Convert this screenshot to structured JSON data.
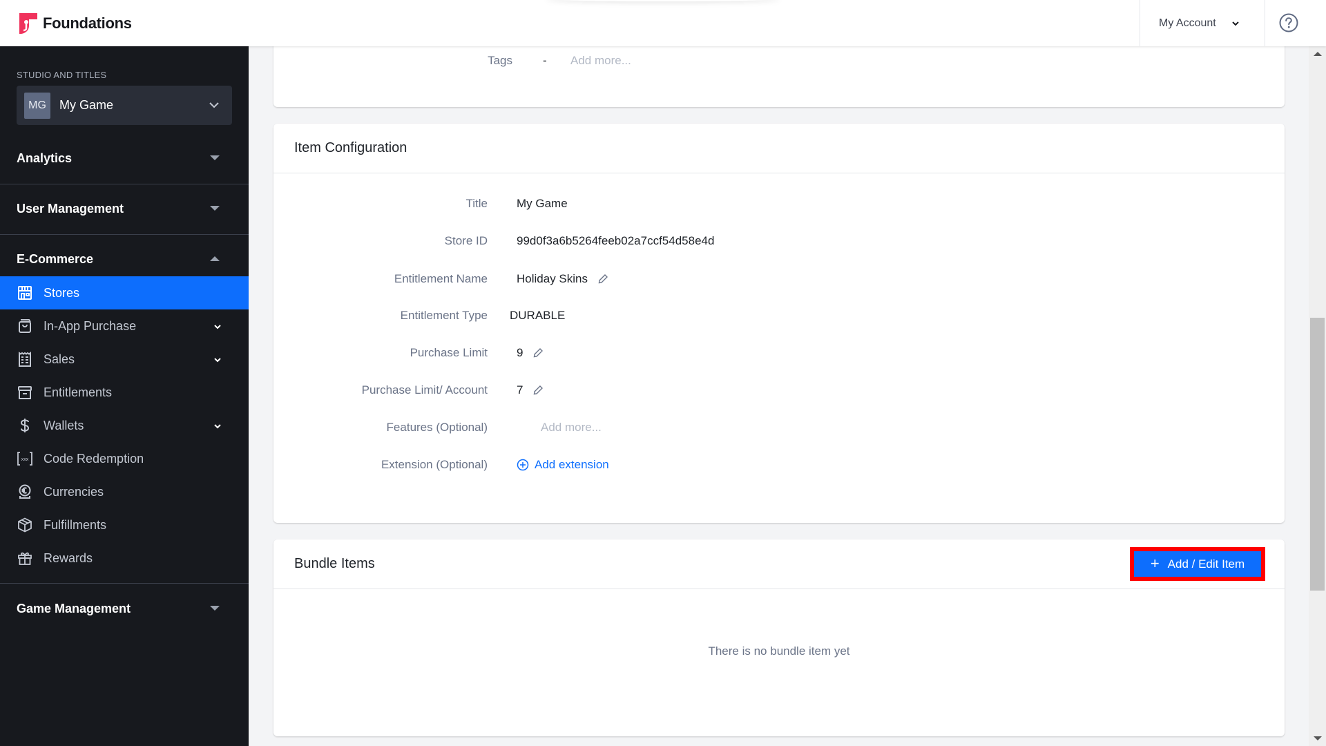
{
  "header": {
    "app_name": "Foundations",
    "account_label": "My Account",
    "brand_color": "#f0325c"
  },
  "sidebar": {
    "studio_label": "STUDIO AND TITLES",
    "studio": {
      "initials": "MG",
      "name": "My Game"
    },
    "sections": [
      {
        "label": "Analytics",
        "expanded": false
      },
      {
        "label": "User Management",
        "expanded": false
      },
      {
        "label": "E-Commerce",
        "expanded": true
      },
      {
        "label": "Game Management",
        "expanded": false
      }
    ],
    "ecommerce_items": [
      {
        "label": "Stores",
        "icon": "store-icon",
        "active": true,
        "has_submenu": false
      },
      {
        "label": "In-App Purchase",
        "icon": "shopping-bag-icon",
        "active": false,
        "has_submenu": true
      },
      {
        "label": "Sales",
        "icon": "receipt-icon",
        "active": false,
        "has_submenu": true
      },
      {
        "label": "Entitlements",
        "icon": "archive-icon",
        "active": false,
        "has_submenu": false
      },
      {
        "label": "Wallets",
        "icon": "dollar-icon",
        "active": false,
        "has_submenu": true
      },
      {
        "label": "Code Redemption",
        "icon": "code-brackets-icon",
        "active": false,
        "has_submenu": false
      },
      {
        "label": "Currencies",
        "icon": "euro-coin-icon",
        "active": false,
        "has_submenu": false
      },
      {
        "label": "Fulfillments",
        "icon": "box-icon",
        "active": false,
        "has_submenu": false
      },
      {
        "label": "Rewards",
        "icon": "gift-icon",
        "active": false,
        "has_submenu": false
      }
    ],
    "active_color": "#0d6efd"
  },
  "top_card": {
    "tags_label": "Tags",
    "tags_value": "-",
    "tags_placeholder": "Add more..."
  },
  "item_configuration": {
    "title": "Item Configuration",
    "rows": [
      {
        "label": "Title",
        "value": "My Game"
      },
      {
        "label": "Store ID",
        "value": "99d0f3a6b5264feeb02a7ccf54d58e4d"
      },
      {
        "label": "Entitlement Name",
        "value": "Holiday Skins",
        "editable": true
      },
      {
        "label": "Entitlement Type",
        "value": "DURABLE"
      },
      {
        "label": "Purchase Limit",
        "value": "9",
        "editable": true
      },
      {
        "label": "Purchase Limit/ Account",
        "value": "7",
        "editable": true
      },
      {
        "label": "Features (Optional)",
        "placeholder": "Add more..."
      },
      {
        "label": "Extension (Optional)",
        "link": "Add extension"
      }
    ]
  },
  "bundle_items": {
    "title": "Bundle Items",
    "add_button": "Add / Edit Item",
    "empty_message": "There is no bundle item yet"
  }
}
